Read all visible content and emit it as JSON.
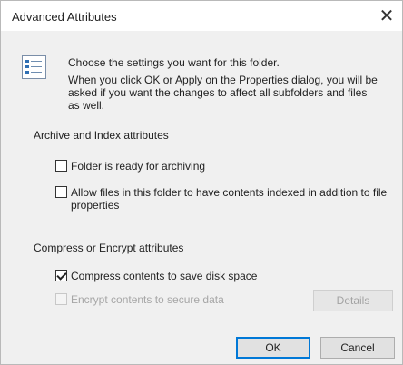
{
  "window": {
    "title": "Advanced Attributes"
  },
  "intro": {
    "line1": "Choose the settings you want for this folder.",
    "line2": "When you click OK or Apply on the Properties dialog, you will be",
    "line3": "asked if you want the changes to affect all subfolders and files",
    "line4": "as well."
  },
  "archive_section": {
    "label": "Archive and Index attributes",
    "archiving": {
      "label": "Folder is ready for archiving",
      "checked": false
    },
    "indexing": {
      "label_line1": "Allow files in this folder to have contents indexed in addition to file",
      "label_line2": "properties",
      "checked": false
    }
  },
  "compress_section": {
    "label": "Compress or Encrypt attributes",
    "compress": {
      "label": "Compress contents to save disk space",
      "checked": true
    },
    "encrypt": {
      "label": "Encrypt contents to secure data",
      "checked": false,
      "enabled": false
    },
    "details_label": "Details"
  },
  "buttons": {
    "ok": "OK",
    "cancel": "Cancel"
  },
  "icons": {
    "close": "close-icon",
    "info": "folder-settings-icon"
  },
  "colors": {
    "accent": "#0078d7",
    "disabled_text": "#a6a6a6"
  }
}
